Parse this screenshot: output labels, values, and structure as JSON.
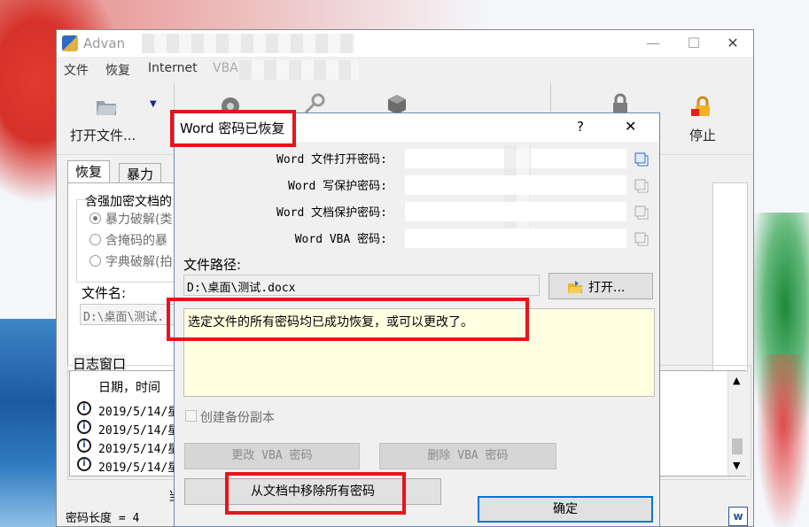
{
  "main_window": {
    "title": "Advan",
    "menu": [
      "文件",
      "恢复",
      "Internet",
      "VBA"
    ],
    "toolbar": {
      "open_label": "打开文件...",
      "stop_label": "停止"
    },
    "tabs": [
      "恢复",
      "暴力"
    ],
    "group_title": "含强加密文档的",
    "options": [
      "暴力破解(类",
      "含掩码的暴",
      "字典破解(拍"
    ],
    "file_label": "文件名:",
    "file_value": "D:\\桌面\\测试.",
    "log_title": "日志窗口",
    "log_header": "日期，时间",
    "log_rows": [
      "2019/5/14/星",
      "2019/5/14/星",
      "2019/5/14/星",
      "2019/5/14/星"
    ],
    "status_text": "密码长度 = 4",
    "status_mid": "当"
  },
  "dialog": {
    "title": "Word 密码已恢复",
    "help": "?",
    "close": "✕",
    "rows": [
      {
        "label": "Word 文件打开密码:"
      },
      {
        "label": "Word 写保护密码:"
      },
      {
        "label": "Word 文档保护密码:"
      },
      {
        "label": "Word VBA 密码:"
      }
    ],
    "path_label": "文件路径:",
    "path_value": "D:\\桌面\\测试.docx",
    "open_button": "打开...",
    "message": "选定文件的所有密码均已成功恢复，或可以更改了。",
    "backup_label": "创建备份副本",
    "change_vba": "更改 VBA 密码",
    "delete_vba": "删除 VBA 密码",
    "remove_all": "从文档中移除所有密码",
    "ok": "确定"
  }
}
